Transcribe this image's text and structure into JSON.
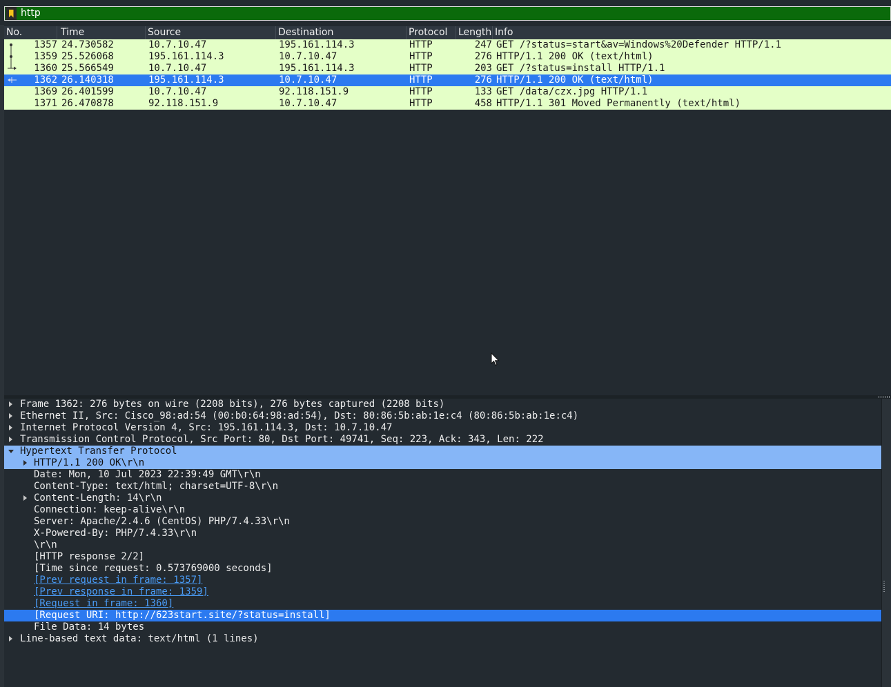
{
  "filter": {
    "value": "http"
  },
  "packet_list": {
    "columns": [
      "No.",
      "Time",
      "Source",
      "Destination",
      "Protocol",
      "Length",
      "Info"
    ],
    "rows": [
      {
        "no": "1357",
        "time": "24.730582",
        "src": "10.7.10.47",
        "dst": "195.161.114.3",
        "proto": "HTTP",
        "len": "247",
        "info": "GET /?status=start&av=Windows%20Defender HTTP/1.1"
      },
      {
        "no": "1359",
        "time": "25.526068",
        "src": "195.161.114.3",
        "dst": "10.7.10.47",
        "proto": "HTTP",
        "len": "276",
        "info": "HTTP/1.1 200 OK  (text/html)"
      },
      {
        "no": "1360",
        "time": "25.566549",
        "src": "10.7.10.47",
        "dst": "195.161.114.3",
        "proto": "HTTP",
        "len": "203",
        "info": "GET /?status=install HTTP/1.1"
      },
      {
        "no": "1362",
        "time": "26.140318",
        "src": "195.161.114.3",
        "dst": "10.7.10.47",
        "proto": "HTTP",
        "len": "276",
        "info": "HTTP/1.1 200 OK  (text/html)"
      },
      {
        "no": "1369",
        "time": "26.401599",
        "src": "10.7.10.47",
        "dst": "92.118.151.9",
        "proto": "HTTP",
        "len": "133",
        "info": "GET /data/czx.jpg HTTP/1.1"
      },
      {
        "no": "1371",
        "time": "26.470878",
        "src": "92.118.151.9",
        "dst": "10.7.10.47",
        "proto": "HTTP",
        "len": "458",
        "info": "HTTP/1.1 301 Moved Permanently  (text/html)"
      }
    ]
  },
  "details": {
    "frame": "Frame 1362: 276 bytes on wire (2208 bits), 276 bytes captured (2208 bits)",
    "ethernet": "Ethernet II, Src: Cisco_98:ad:54 (00:b0:64:98:ad:54), Dst: 80:86:5b:ab:1e:c4 (80:86:5b:ab:1e:c4)",
    "ip": "Internet Protocol Version 4, Src: 195.161.114.3, Dst: 10.7.10.47",
    "tcp": "Transmission Control Protocol, Src Port: 80, Dst Port: 49741, Seq: 223, Ack: 343, Len: 222",
    "http": "Hypertext Transfer Protocol",
    "status_line": "HTTP/1.1 200 OK\\r\\n",
    "date": "Date: Mon, 10 Jul 2023 22:39:49 GMT\\r\\n",
    "content_type": "Content-Type: text/html; charset=UTF-8\\r\\n",
    "content_length": "Content-Length: 14\\r\\n",
    "connection": "Connection: keep-alive\\r\\n",
    "server": "Server: Apache/2.4.6 (CentOS) PHP/7.4.33\\r\\n",
    "powered_by": "X-Powered-By: PHP/7.4.33\\r\\n",
    "crlf": "\\r\\n",
    "response_num": "[HTTP response 2/2]",
    "time_since": "[Time since request: 0.573769000 seconds]",
    "prev_request": "[Prev request in frame: 1357]",
    "prev_response": "[Prev response in frame: 1359]",
    "request_in": "[Request in frame: 1360]",
    "request_uri": "[Request URI: http://623start.site/?status=install]",
    "file_data": "File Data: 14 bytes",
    "line_based": "Line-based text data: text/html (1 lines)"
  },
  "colors": {
    "row_http": "#e4ffc7",
    "selected": "#2c7af0",
    "expanded": "#86b6f7",
    "filter_ok": "#0b6a0b"
  }
}
